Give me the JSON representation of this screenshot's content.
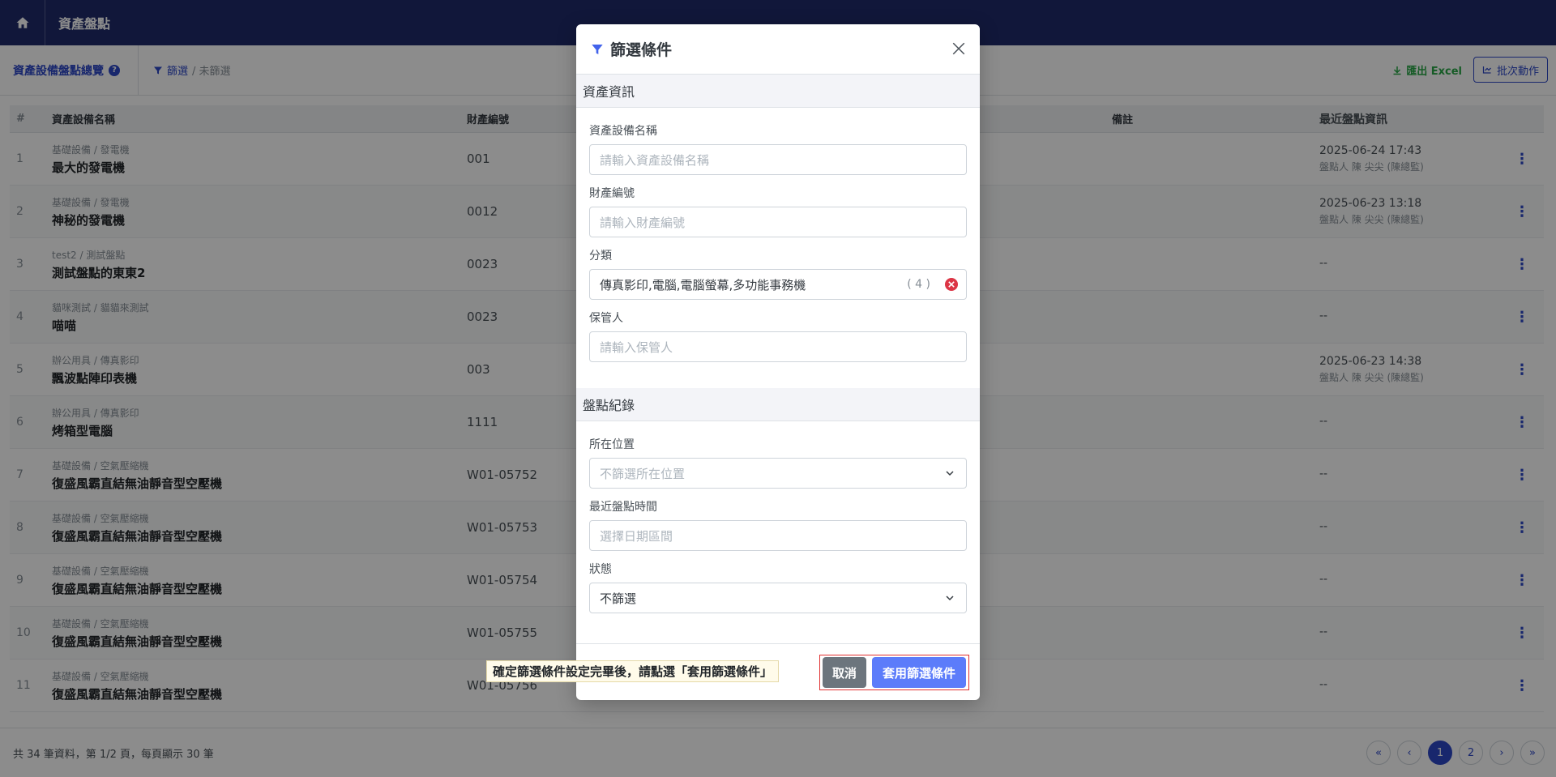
{
  "topbar": {
    "title": "資產盤點"
  },
  "subbar": {
    "page_title": "資產設備盤點總覽",
    "filter_label": "篩選",
    "filter_status": "/ 未篩選",
    "export_label": "匯出 Excel",
    "batch_label": "批次動作"
  },
  "table": {
    "headers": [
      "#",
      "資產設備名稱",
      "財產編號",
      "備註",
      "最近盤點資訊"
    ],
    "rows": [
      {
        "no": "1",
        "category": "基礎設備 / 發電機",
        "name": "最大的發電機",
        "code": "001",
        "last": "2025-06-24 17:43",
        "last_sub": "盤點人 陳 尖尖 (陳總監)"
      },
      {
        "no": "2",
        "category": "基礎設備 / 發電機",
        "name": "神秘的發電機",
        "code": "0012",
        "last": "2025-06-23 13:18",
        "last_sub": "盤點人 陳 尖尖 (陳總監)"
      },
      {
        "no": "3",
        "category": "test2 / 測試盤點",
        "name": "測試盤點的東東2",
        "code": "0023",
        "last": "--",
        "last_sub": ""
      },
      {
        "no": "4",
        "category": "貓咪測試 / 貓貓來測試",
        "name": "喵喵",
        "code": "0023",
        "last": "--",
        "last_sub": ""
      },
      {
        "no": "5",
        "category": "辦公用具 / 傳真影印",
        "name": "飄波點陣印表機",
        "code": "003",
        "last": "2025-06-23 14:38",
        "last_sub": "盤點人 陳 尖尖 (陳總監)"
      },
      {
        "no": "6",
        "category": "辦公用具 / 傳真影印",
        "name": "烤箱型電腦",
        "code": "1111",
        "last": "--",
        "last_sub": ""
      },
      {
        "no": "7",
        "category": "基礎設備 / 空氣壓縮機",
        "name": "復盛風霸直結無油靜音型空壓機",
        "code": "W01-05752",
        "last": "--",
        "last_sub": ""
      },
      {
        "no": "8",
        "category": "基礎設備 / 空氣壓縮機",
        "name": "復盛風霸直結無油靜音型空壓機",
        "code": "W01-05753",
        "last": "--",
        "last_sub": ""
      },
      {
        "no": "9",
        "category": "基礎設備 / 空氣壓縮機",
        "name": "復盛風霸直結無油靜音型空壓機",
        "code": "W01-05754",
        "last": "--",
        "last_sub": ""
      },
      {
        "no": "10",
        "category": "基礎設備 / 空氣壓縮機",
        "name": "復盛風霸直結無油靜音型空壓機",
        "code": "W01-05755",
        "last": "--",
        "last_sub": ""
      },
      {
        "no": "11",
        "category": "基礎設備 / 空氣壓縮機",
        "name": "復盛風霸直結無油靜音型空壓機",
        "code": "W01-05756",
        "last": "--",
        "last_sub": ""
      }
    ]
  },
  "footer": {
    "info": "共 34 筆資料，第 1/2 頁，每頁顯示 30 筆",
    "pages": [
      "1",
      "2"
    ]
  },
  "modal": {
    "title": "篩選條件",
    "section_asset": "資產資訊",
    "section_record": "盤點紀錄",
    "name_label": "資產設備名稱",
    "name_placeholder": "請輸入資產設備名稱",
    "code_label": "財產編號",
    "code_placeholder": "請輸入財產編號",
    "category_label": "分類",
    "category_value": "傳真影印,電腦,電腦螢幕,多功能事務機",
    "category_count": "( 4 )",
    "keeper_label": "保管人",
    "keeper_placeholder": "請輸入保管人",
    "location_label": "所在位置",
    "location_value": "不篩選所在位置",
    "date_label": "最近盤點時間",
    "date_placeholder": "選擇日期區間",
    "status_label": "狀態",
    "status_value": "不篩選",
    "cancel_label": "取消",
    "apply_label": "套用篩選條件",
    "tip": "確定篩選條件設定完畢後，請點選「套用篩選條件」"
  },
  "colors": {
    "primary": "#2d47c7",
    "nav": "#1f2a6b",
    "apply": "#5c7cfa",
    "danger": "#dc3545"
  }
}
